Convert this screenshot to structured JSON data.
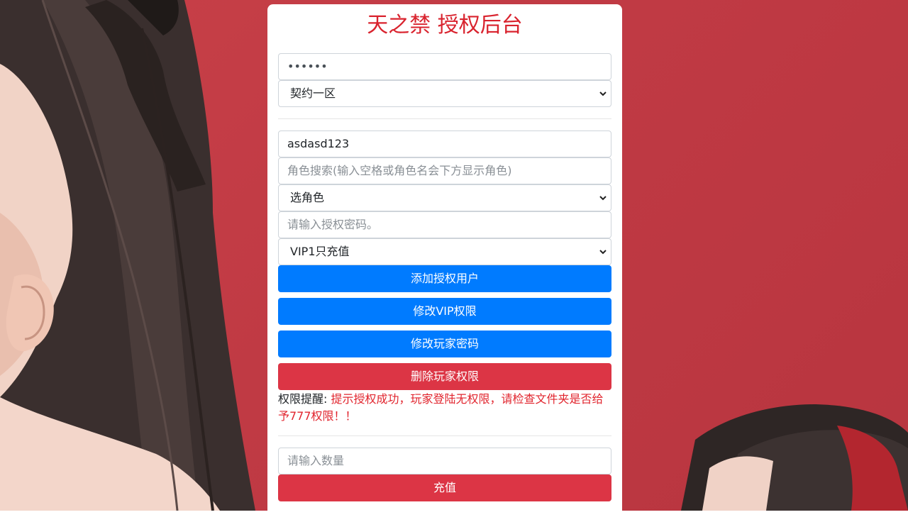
{
  "header": {
    "title": "天之禁 授权后台"
  },
  "login": {
    "password_value": "••••••",
    "server_select": {
      "selected": "契约一区"
    }
  },
  "authorize": {
    "account_value": "asdasd123",
    "role_search_placeholder": "角色搜索(输入空格或角色名会下方显示角色)",
    "role_select": {
      "selected": "选角色"
    },
    "auth_password_placeholder": "请输入授权密码。",
    "vip_select": {
      "selected": "VIP1只充值"
    },
    "add_user_label": "添加授权用户",
    "modify_vip_label": "修改VIP权限",
    "modify_password_label": "修改玩家密码",
    "delete_permission_label": "删除玩家权限"
  },
  "notice": {
    "label": "权限提醒:",
    "message": "提示授权成功，玩家登陆无权限，请检查文件夹是否给予777权限！！"
  },
  "recharge": {
    "amount_placeholder": "请输入数量",
    "recharge_label": "充值"
  },
  "colors": {
    "title": "#d9232e",
    "primary_button": "#007bff",
    "danger_button": "#dc3545",
    "notice_text": "#e1242d",
    "background": "#c03a44"
  }
}
